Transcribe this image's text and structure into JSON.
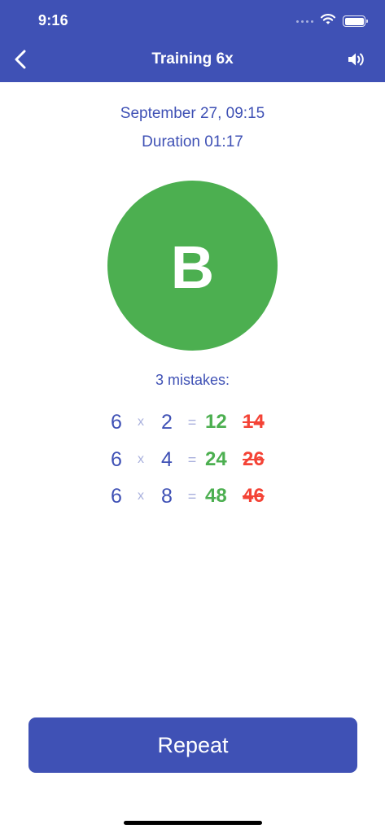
{
  "status_bar": {
    "time": "9:16"
  },
  "nav": {
    "title": "Training 6x",
    "back_icon": "chevron-left-icon",
    "sound_icon": "speaker-volume-icon"
  },
  "session": {
    "date": "September 27, 09:15",
    "duration_label": "Duration",
    "duration_value": "01:17"
  },
  "grade": {
    "letter": "B",
    "color": "#4caf50"
  },
  "mistakes": {
    "title": "3 mistakes:",
    "operator": "x",
    "equals": "=",
    "rows": [
      {
        "a": "6",
        "b": "2",
        "correct": "12",
        "wrong": "14"
      },
      {
        "a": "6",
        "b": "4",
        "correct": "24",
        "wrong": "26"
      },
      {
        "a": "6",
        "b": "8",
        "correct": "48",
        "wrong": "46"
      }
    ]
  },
  "actions": {
    "repeat_label": "Repeat"
  },
  "colors": {
    "primary": "#3f51b5",
    "correct": "#4caf50",
    "wrong": "#f44336",
    "muted": "#a9b0dd"
  }
}
